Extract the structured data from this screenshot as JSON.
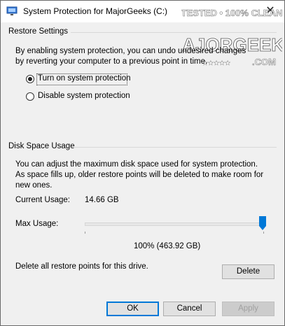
{
  "window": {
    "title": "System Protection for MajorGeeks (C:)",
    "close_glyph": "✕"
  },
  "watermark": {
    "line1": "TESTED • 100% CLEAN",
    "line2": "MAJORGEEKS",
    "line3": ".COM",
    "stars": "★★★★★"
  },
  "restore_settings": {
    "heading": "Restore Settings",
    "description": "By enabling system protection, you can undo undesired changes by reverting your computer to a previous point in time.",
    "options": [
      {
        "label": "Turn on system protection",
        "selected": true
      },
      {
        "label": "Disable system protection",
        "selected": false
      }
    ]
  },
  "disk_space": {
    "heading": "Disk Space Usage",
    "description": "You can adjust the maximum disk space used for system protection. As space fills up, older restore points will be deleted to make room for new ones.",
    "current_usage_label": "Current Usage:",
    "current_usage_value": "14.66 GB",
    "max_usage_label": "Max Usage:",
    "max_usage_percent": 100,
    "max_usage_readout": "100% (463.92 GB)",
    "delete_text": "Delete all restore points for this drive.",
    "delete_button": "Delete"
  },
  "footer": {
    "ok": "OK",
    "cancel": "Cancel",
    "apply": "Apply"
  }
}
